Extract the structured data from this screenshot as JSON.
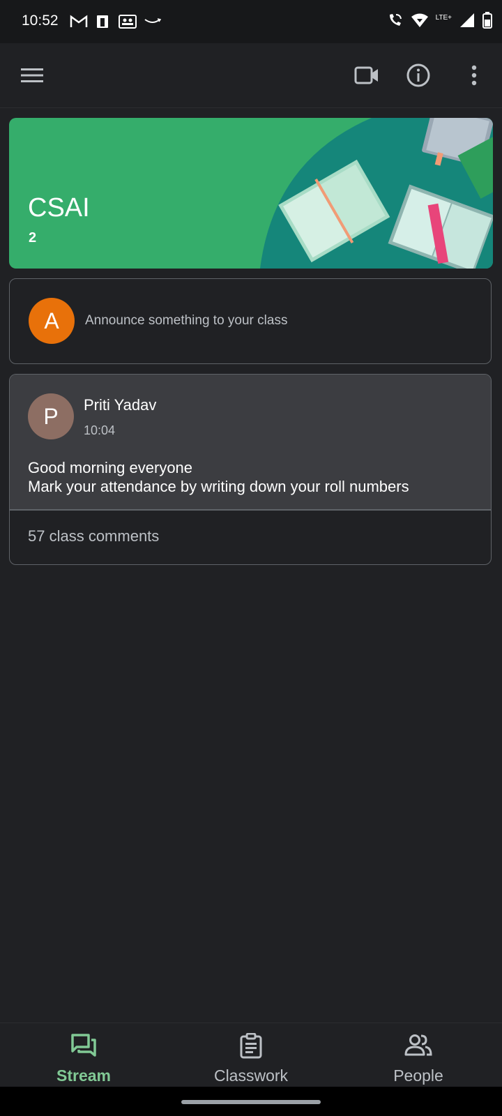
{
  "status_bar": {
    "time": "10:52",
    "network_label": "LTE+",
    "left_icons": [
      "gmail-icon",
      "sim-card-icon",
      "teams-icon",
      "amazon-icon"
    ],
    "right_icons": [
      "wifi-calling-icon",
      "wifi-icon",
      "signal-icon",
      "battery-icon"
    ]
  },
  "app_bar": {
    "icons": [
      "menu-icon",
      "video-call-icon",
      "info-icon",
      "more-vert-icon"
    ]
  },
  "class_banner": {
    "title": "CSAI",
    "section": "2",
    "color": "#35ad6b"
  },
  "announce": {
    "avatar_letter": "A",
    "avatar_color": "#e8710a",
    "placeholder": "Announce something to your class"
  },
  "post": {
    "avatar_letter": "P",
    "avatar_color": "#8d6e63",
    "author": "Priti Yadav",
    "time": "10:04",
    "line1": "Good morning everyone",
    "line2": "Mark your attendance by writing down your roll numbers",
    "comments": "57 class comments"
  },
  "bottom_nav": {
    "items": [
      {
        "label": "Stream",
        "icon": "stream-icon",
        "active": true
      },
      {
        "label": "Classwork",
        "icon": "classwork-icon",
        "active": false
      },
      {
        "label": "People",
        "icon": "people-icon",
        "active": false
      }
    ],
    "active_color": "#81c995"
  }
}
